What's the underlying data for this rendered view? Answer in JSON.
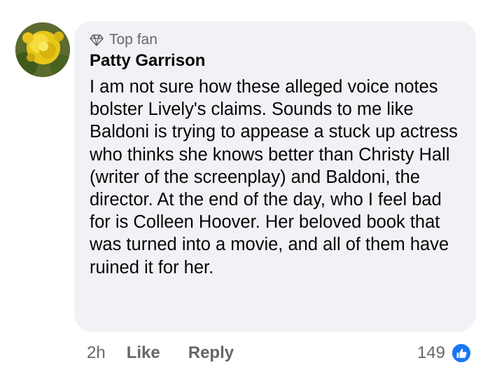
{
  "comment": {
    "badge": "Top fan",
    "author": "Patty Garrison",
    "text": "I am not sure how these alleged voice notes bolster Lively's claims. Sounds to me like Baldoni is trying to appease a stuck up actress who thinks she knows better than Christy Hall (writer of the screenplay) and Baldoni, the director. At the end of the day, who I feel bad for is Colleen Hoover. Her beloved book that was turned into a movie, and all of them have ruined it for her.",
    "timestamp": "2h",
    "like_label": "Like",
    "reply_label": "Reply",
    "reaction_count": "149",
    "reaction_icon": "thumbs-up-icon",
    "badge_icon": "diamond-icon",
    "colors": {
      "bubble": "#f0f2f5",
      "meta": "#65676b",
      "reaction": "#1877f2"
    }
  }
}
